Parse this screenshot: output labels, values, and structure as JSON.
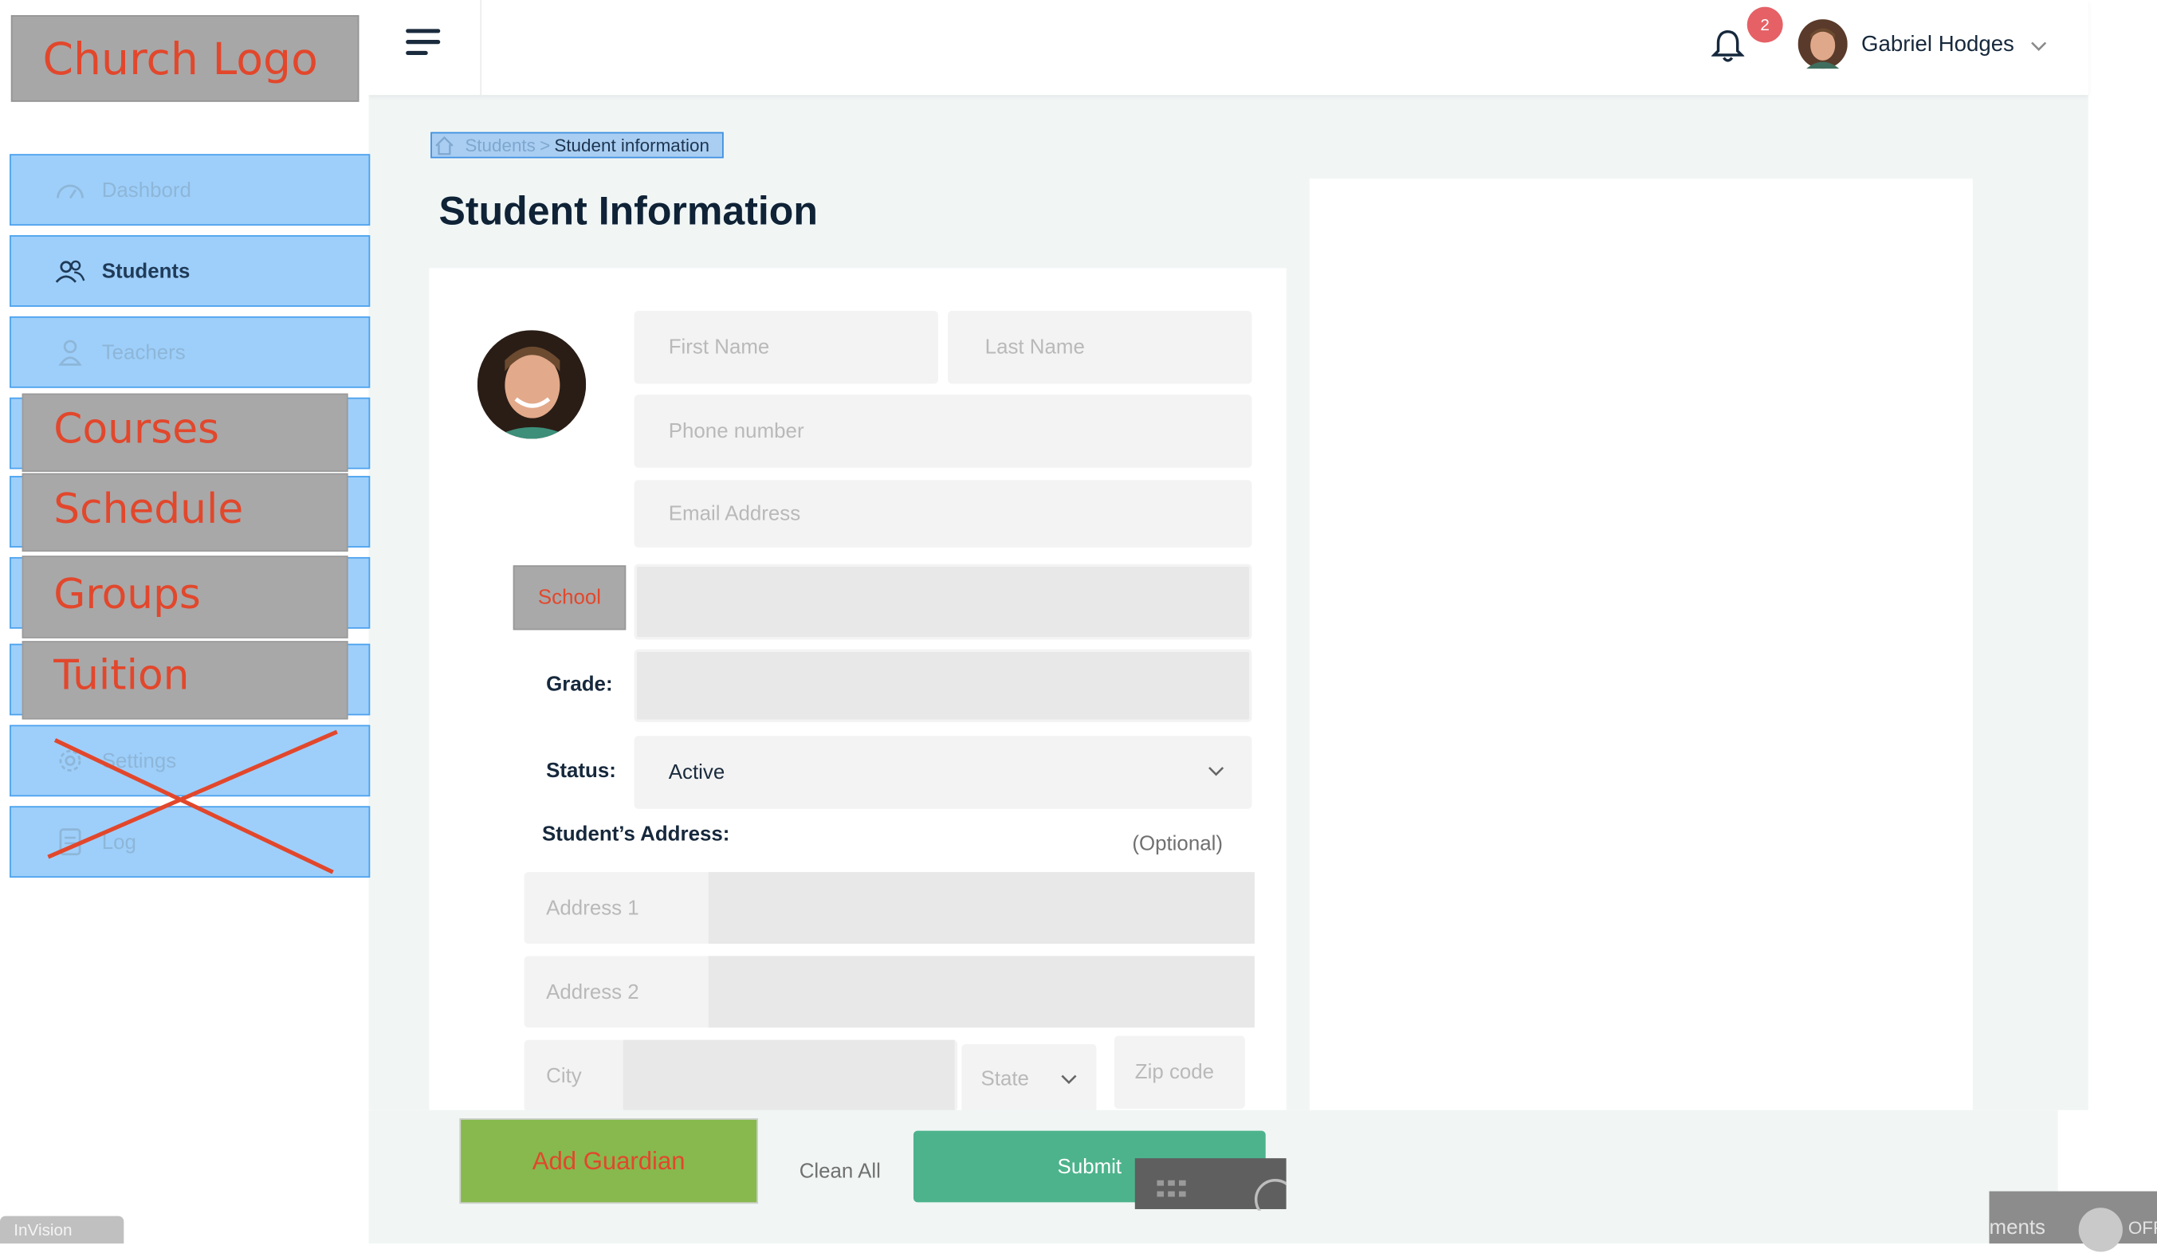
{
  "logo": {
    "text": "Church Logo"
  },
  "sidebar": {
    "items": [
      {
        "label": "Dashbord",
        "icon": "dashboard-icon"
      },
      {
        "label": "Students",
        "icon": "students-icon",
        "active": true
      },
      {
        "label": "Teachers",
        "icon": "teacher-icon"
      },
      {
        "label": "",
        "icon": ""
      },
      {
        "label": "",
        "icon": ""
      },
      {
        "label": "",
        "icon": ""
      },
      {
        "label": "",
        "icon": ""
      },
      {
        "label": "Settings",
        "icon": "gear-icon",
        "crossed": true
      },
      {
        "label": "Log",
        "icon": "log-icon",
        "crossed": true
      }
    ],
    "overlays": [
      "Courses",
      "Schedule",
      "Groups",
      "Tuition"
    ]
  },
  "header": {
    "notification_count": "2",
    "user_name": "Gabriel Hodges"
  },
  "breadcrumb": {
    "parent": "Students",
    "separator": ">",
    "current": "Student information"
  },
  "page_title": "Student Information",
  "form": {
    "first_name_placeholder": "First Name",
    "last_name_placeholder": "Last Name",
    "phone_placeholder": "Phone number",
    "email_placeholder": "Email Address",
    "school_label": "School",
    "grade_label": "Grade:",
    "status_label": "Status:",
    "status_value": "Active",
    "address_label": "Student’s Address:",
    "optional_label": "(Optional)",
    "address1_placeholder": "Address 1",
    "address2_placeholder": "Address 2",
    "city_placeholder": "City",
    "state_placeholder": "State",
    "zip_placeholder": "Zip code"
  },
  "actions": {
    "add_guardian": "Add Guardian",
    "clean_all": "Clean All",
    "submit": "Submit"
  },
  "overlay_bar": {
    "invision_label": "InVision",
    "comments_fragment": "ments",
    "off_fragment": "OFF"
  },
  "colors": {
    "nav_bg": "#9ecffa",
    "overlay_gray": "#a8a8a8",
    "overlay_text": "#e2472c",
    "submit": "#4db38c",
    "guardian": "#87b94e",
    "badge": "#e56166"
  }
}
